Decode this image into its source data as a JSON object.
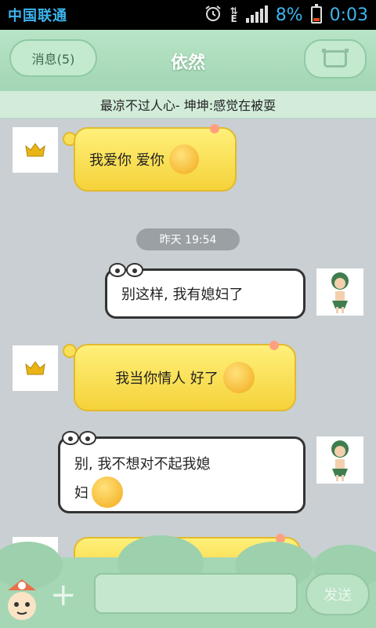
{
  "status_bar": {
    "carrier": "中国联通",
    "network": "E",
    "battery": "8%",
    "time": "0:03"
  },
  "header": {
    "back_label": "消息(5)",
    "title": "依然"
  },
  "signature": "最凉不过人心- 坤坤:感觉在被耍",
  "messages": [
    {
      "side": "left",
      "text": "我爱你 爱你",
      "emoji": "kiss-emoji"
    },
    {
      "timestamp": "昨天 19:54"
    },
    {
      "side": "right",
      "text": "别这样, 我有媳妇了"
    },
    {
      "side": "left",
      "text": "我当你情人 好了",
      "emoji": "dizzy-emoji"
    },
    {
      "side": "right",
      "text_line1": "别, 我不想对不起我媳",
      "text_line2": "妇",
      "emoji": "sweat-emoji"
    }
  ],
  "bottom": {
    "send_label": "发送"
  }
}
